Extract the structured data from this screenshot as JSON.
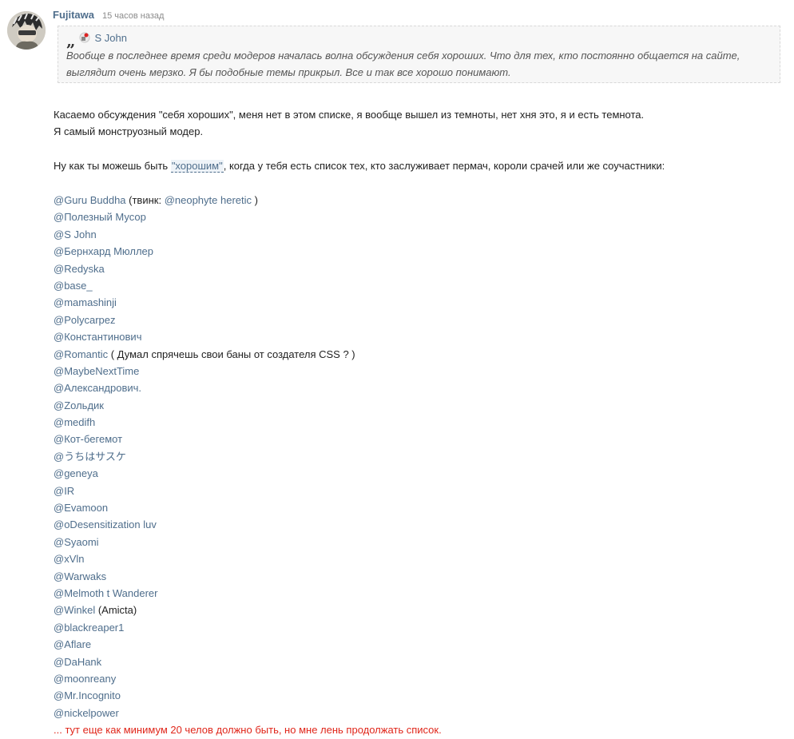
{
  "post": {
    "author": "Fujitawa",
    "time": "15 часов назад"
  },
  "quote": {
    "author": "S John",
    "text": "Вообще в последнее время среди модеров началась волна обсуждения себя хороших. Что для тех, кто постоянно общается на сайте, выглядит очень мерзко. Я бы подобные темы прикрыл. Все и так все хорошо понимают."
  },
  "body": {
    "p1_line1": "Касаемо обсуждения \"себя хороших\", меня нет в этом списке, я вообще вышел из темноты, нет хня это, я и есть темнота.",
    "p1_line2": "Я самый монструозный модер.",
    "p2_before": "Ну как ты можешь быть ",
    "p2_highlight": "\"хорошим\"",
    "p2_after": ", когда у тебя есть список тех, кто заслуживает пермач, короли срачей или же соучастники:"
  },
  "mentions": [
    {
      "name": "@Guru Buddha",
      "suffix_before": " (твинк: ",
      "extra_mention": "@neophyte heretic",
      "suffix_after": " )"
    },
    {
      "name": "@Полезный Мусор"
    },
    {
      "name": "@S John"
    },
    {
      "name": "@Бернхард Мюллер"
    },
    {
      "name": "@Redyska"
    },
    {
      "name": "@base_"
    },
    {
      "name": "@mamashinji"
    },
    {
      "name": "@Polycarpez"
    },
    {
      "name": "@Константинович"
    },
    {
      "name": "@Romantic",
      "suffix_after": " ( Думал спрячешь свои баны от создателя CSS ? )"
    },
    {
      "name": "@MaybeNextTime"
    },
    {
      "name": "@Александрович."
    },
    {
      "name": "@Zольдик"
    },
    {
      "name": "@medifh"
    },
    {
      "name": "@Кот-бегемот"
    },
    {
      "name": "@うちはサスケ"
    },
    {
      "name": "@geneya"
    },
    {
      "name": "@IR"
    },
    {
      "name": "@Evamoon"
    },
    {
      "name": "@oDesensitization luv"
    },
    {
      "name": "@Syaomi"
    },
    {
      "name": "@xVln"
    },
    {
      "name": "@Warwaks"
    },
    {
      "name": "@Melmoth t Wanderer"
    },
    {
      "name": "@Winkel",
      "suffix_after": " (Amicta)"
    },
    {
      "name": "@blackreaper1"
    },
    {
      "name": "@Aflare"
    },
    {
      "name": "@DaHank"
    },
    {
      "name": "@moonreany"
    },
    {
      "name": "@Mr.Incognito"
    },
    {
      "name": "@nickelpower"
    }
  ],
  "footer_note": "... тут еще как минимум 20 челов должно быть, но мне лень продолжать список.",
  "colors": {
    "link": "#4f6e8c",
    "note": "#e0261a"
  }
}
